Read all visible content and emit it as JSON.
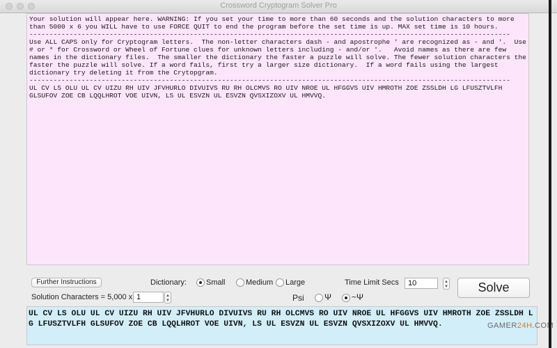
{
  "window": {
    "title": "Crossword Cryptogram Solver Pro"
  },
  "instructions": {
    "text": "Your solution will appear here. WARNING: If you set your time to more than 60 seconds and the solution characters to more than 5000 x 6 you WILL have to use FORCE QUIT to end the program before the set time is up. MAX set time is 10 hours.\n------------------------------------------------------------------------------------------------------------------------\nUse ALL CAPS only for Cryptogram letters.  The non-letter characters dash - and apostrophe ' are recognized as - and '.  Use # or * for Crossword or Wheel of Fortune clues for unknown letters including - and/or '.   Avoid names as there are few names in the dictionary files.  The smaller the dictionary the faster a puzzle will solve. The fewer solution characters the faster the puzzle will solve. If a word fails, first try a larger size dictionary.  If a word fails using the largest dictionary try deleting it from the Crytopgram.\n------------------------------------------------------------------------------------------------------------------------\nUL CV LS OLU UL CV UIZU RH UIV JFVHURLO DIVUIVS RU RH OLCMVS RO UIV NROE UL HFGGVS UIV HMROTH ZOE ZSSLDH LG LFUSZTVLFH GLSUFOV ZOE CB LQQLHROT VOE UIVN, LS UL ESVZN UL ESVZN QVSXIZOXV UL HMVVQ."
  },
  "controls": {
    "further_instructions": "Further Instructions",
    "dictionary_label": "Dictionary:",
    "dictionary_options": [
      "Small",
      "Medium",
      "Large"
    ],
    "dictionary_selected": "Small",
    "time_limit_label": "Time Limit Secs",
    "time_limit_value": "10",
    "solve_label": "Solve",
    "solution_chars_label": "Solution Characters = 5,000 x",
    "solution_chars_value": "1",
    "psi_label": "Psi",
    "psi_options": [
      "Ψ",
      "~Ψ"
    ],
    "psi_selected": "~Ψ"
  },
  "input": {
    "text": "UL CV LS OLU UL CV UIZU RH UIV JFVHURLO DIVUIVS RU RH OLCMVS RO UIV NROE UL HFGGVS UIV HMROTH ZOE ZSSLDH LG LFUSZTVLFH GLSUFOV ZOE CB LQQLHROT VOE UIVN, LS UL ESVZN UL ESVZN QVSXIZOXV UL HMVVQ."
  },
  "watermark": {
    "part1": "GAMER",
    "part2": "24H",
    "part3": ".COM"
  },
  "colors": {
    "top_bg": "#fde6fc",
    "bottom_bg": "#d2eef9"
  }
}
